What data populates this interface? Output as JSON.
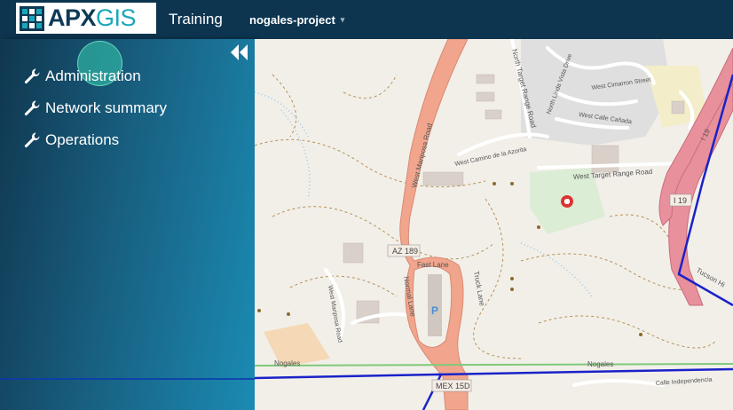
{
  "header": {
    "logo": {
      "part1": "APX",
      "part2": "GIS"
    },
    "app_title": "Training",
    "project": "nogales-project",
    "project_caret": "▾"
  },
  "sidebar": {
    "collapse_icon": "double-chevron-left-icon",
    "items": [
      {
        "label": "Administration",
        "icon": "wrench-icon"
      },
      {
        "label": "Network summary",
        "icon": "wrench-icon"
      },
      {
        "label": "Operations",
        "icon": "wrench-icon"
      }
    ]
  },
  "map": {
    "labels": {
      "west_mariposa_road": "West Mariposa Road",
      "az189": "AZ 189",
      "fast_lane": "Fast Lane",
      "normal_lane": "Normal Lane",
      "truck_lane": "Truck Lane",
      "north_target_range_road": "North Target Range Road",
      "west_target_range_road": "West Target Range Road",
      "west_camino": "West Camino de la Azorita",
      "north_linda_vista": "North Linda Vista Drive",
      "west_cimarron": "West Cimarron Street",
      "west_calle_canada": "West Calle Cañada",
      "i19": "I 19",
      "mex15d": "MEX 15D",
      "nogales1": "Nogales",
      "nogales2": "Nogales",
      "w_mariposa_road_small": "West Mariposa Road",
      "calle_independencia": "Calle Independencia",
      "tucson": "Tucson Hi",
      "parking": "P"
    }
  },
  "colors": {
    "header_bg": "#0d3550",
    "accent": "#1aa7b8",
    "route_blue": "#1a22c8",
    "highway_pink": "#e8909c",
    "road_salmon": "#f0a58c"
  }
}
